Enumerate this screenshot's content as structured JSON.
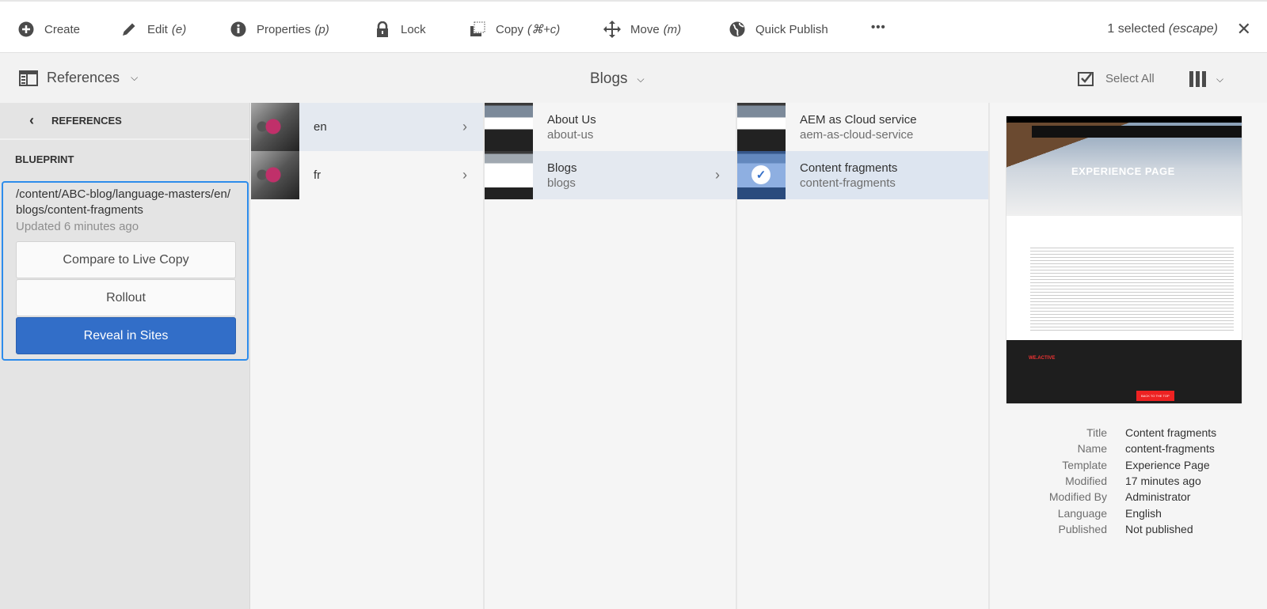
{
  "toolbar": {
    "items": [
      {
        "label": "Create",
        "shortcut": "",
        "icon": "plus-circle-icon"
      },
      {
        "label": "Edit",
        "shortcut": "(e)",
        "icon": "pencil-icon"
      },
      {
        "label": "Properties",
        "shortcut": "(p)",
        "icon": "info-icon"
      },
      {
        "label": "Lock",
        "shortcut": "",
        "icon": "lock-icon"
      },
      {
        "label": "Copy",
        "shortcut": "(⌘+c)",
        "icon": "copy-icon"
      },
      {
        "label": "Move",
        "shortcut": "(m)",
        "icon": "move-icon"
      },
      {
        "label": "Quick Publish",
        "shortcut": "",
        "icon": "globe-icon"
      }
    ],
    "more": "•••",
    "selection": "1 selected",
    "selection_hint": "(escape)",
    "close": "✕"
  },
  "subheader": {
    "rail_label": "References",
    "title": "Blogs",
    "select_all": "Select All"
  },
  "rail": {
    "back": "‹",
    "heading": "REFERENCES",
    "section": "BLUEPRINT",
    "path": "/content/ABC-blog/language-masters/en/blogs/content-fragments",
    "updated": "Updated 6 minutes ago",
    "buttons": [
      "Compare to Live Copy",
      "Rollout",
      "Reveal in Sites"
    ],
    "accent": "#326ec8"
  },
  "columns": [
    [
      {
        "title": "en",
        "name": "",
        "state": "active",
        "thumb": "cat"
      },
      {
        "title": "fr",
        "name": "",
        "state": "",
        "thumb": "cat"
      }
    ],
    [
      {
        "title": "About Us",
        "name": "about-us",
        "state": "",
        "thumb": "page"
      },
      {
        "title": "Blogs",
        "name": "blogs",
        "state": "active",
        "thumb": "page2"
      }
    ],
    [
      {
        "title": "AEM as Cloud service",
        "name": "aem-as-cloud-service",
        "state": "",
        "thumb": "page"
      },
      {
        "title": "Content fragments",
        "name": "content-fragments",
        "state": "selected",
        "thumb": "page2"
      }
    ]
  ],
  "preview": {
    "hero": "EXPERIENCE PAGE",
    "brand": "WE.ACTIVE",
    "footer_button": "BACK TO THE TOP"
  },
  "meta": [
    {
      "k": "Title",
      "v": "Content fragments"
    },
    {
      "k": "Name",
      "v": "content-fragments"
    },
    {
      "k": "Template",
      "v": "Experience Page"
    },
    {
      "k": "Modified",
      "v": "17 minutes ago"
    },
    {
      "k": "Modified By",
      "v": "Administrator"
    },
    {
      "k": "Language",
      "v": "English"
    },
    {
      "k": "Published",
      "v": "Not published"
    }
  ]
}
